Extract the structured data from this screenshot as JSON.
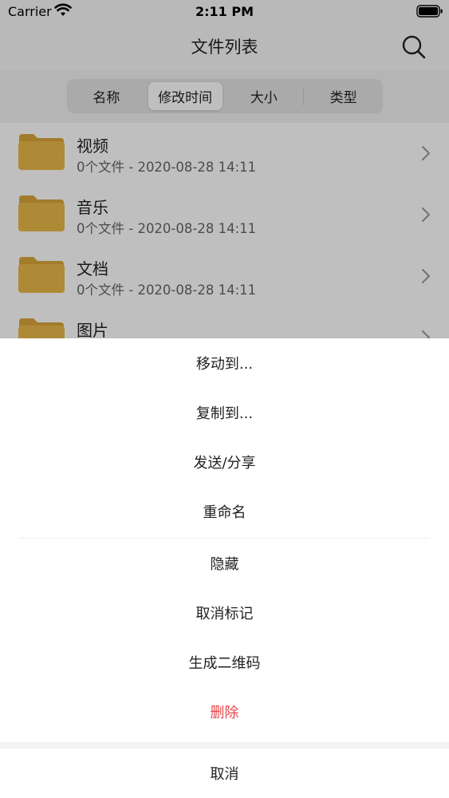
{
  "status_bar": {
    "carrier": "Carrier",
    "time": "2:11 PM"
  },
  "nav": {
    "title": "文件列表",
    "search_icon": "search-icon"
  },
  "sort_segments": {
    "items": [
      "名称",
      "修改时间",
      "大小",
      "类型"
    ],
    "selected": "修改时间"
  },
  "files": [
    {
      "name": "视频",
      "meta": "0个文件 - 2020-08-28 14:11"
    },
    {
      "name": "音乐",
      "meta": "0个文件 - 2020-08-28 14:11"
    },
    {
      "name": "文档",
      "meta": "0个文件 - 2020-08-28 14:11"
    },
    {
      "name": "图片",
      "meta": ""
    }
  ],
  "action_sheet": {
    "items": [
      "移动到...",
      "复制到...",
      "发送/分享",
      "重命名",
      "隐藏",
      "取消标记",
      "生成二维码",
      "删除"
    ],
    "danger_item": "删除",
    "cancel": "取消"
  },
  "colors": {
    "folder": "#e8b84a",
    "folder_tab": "#d9a63a",
    "danger": "#e5484d",
    "overlay": "rgba(0,0,0,0.25)"
  }
}
